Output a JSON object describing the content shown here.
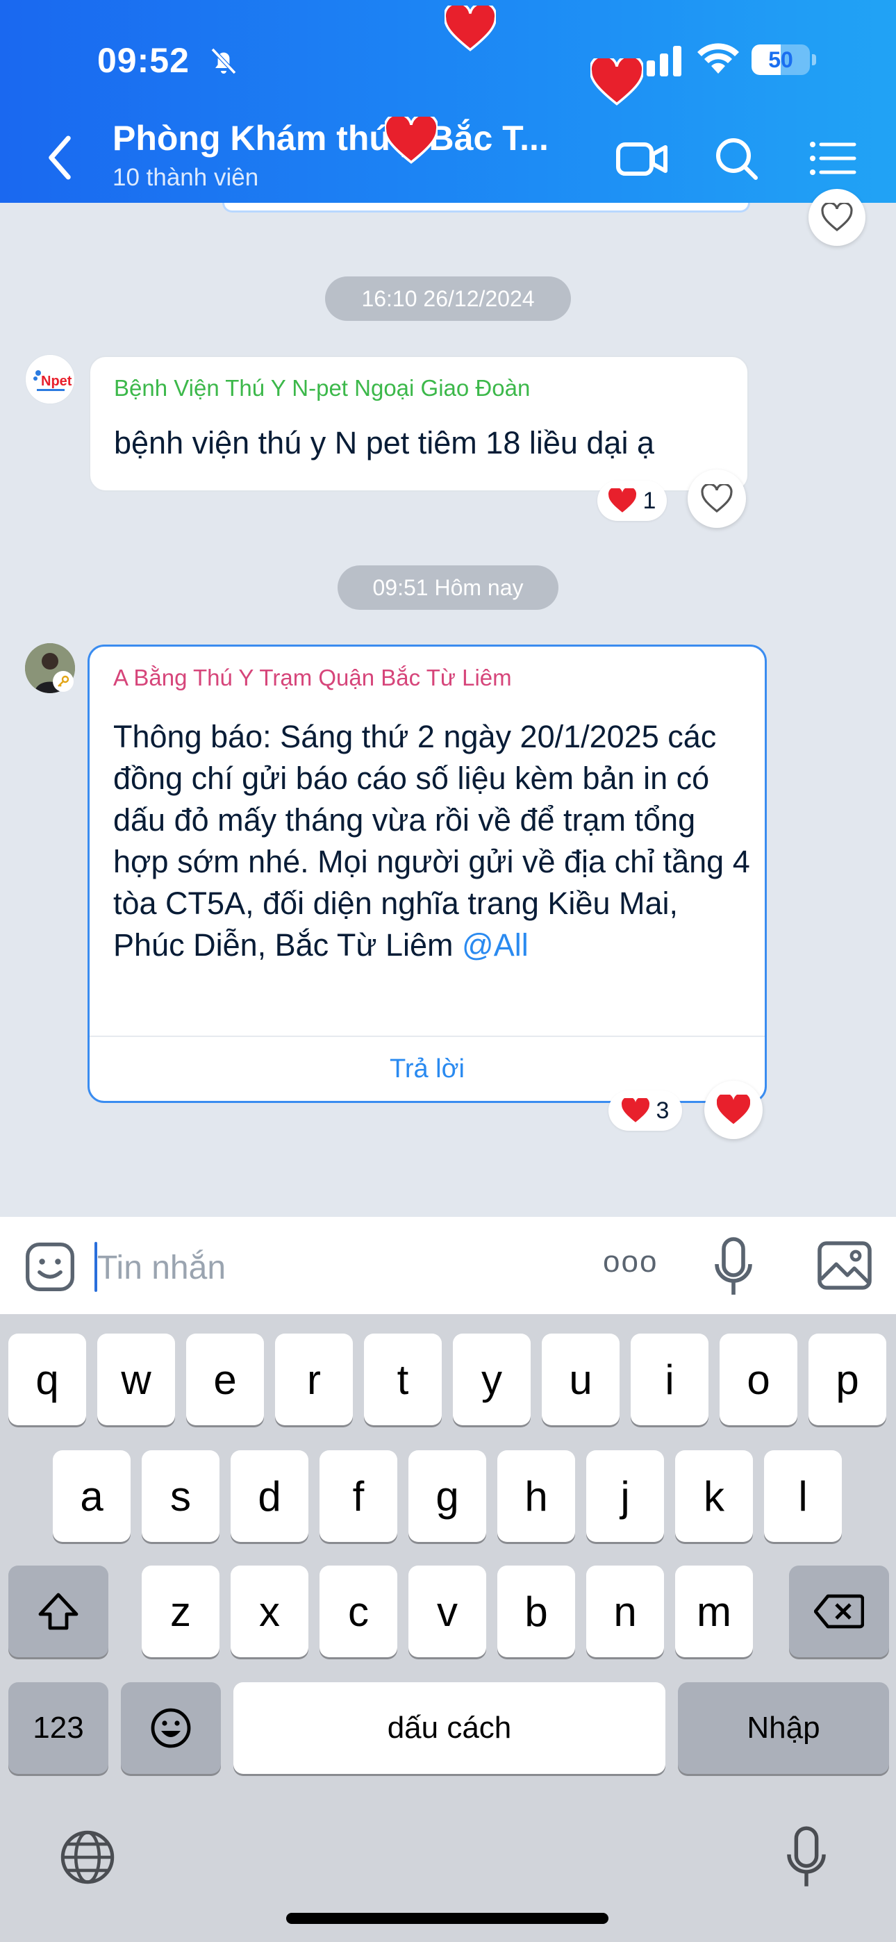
{
  "status_bar": {
    "time": "09:52",
    "battery": "50",
    "battery_level": 0.5
  },
  "header": {
    "title": "Phòng Khám thú y Bắc T...",
    "subtitle": "10 thành viên"
  },
  "messages": [
    {
      "timestamp": "16:10 26/12/2024",
      "sender": "Bệnh Viện Thú Y N-pet Ngoại Giao Đoàn",
      "avatar_text": "Npet",
      "sender_color": "#3cb84a",
      "text": "bệnh viện thú y N pet tiêm 18 liều dại ạ",
      "reaction_count": "1"
    },
    {
      "timestamp": "09:51 Hôm nay",
      "sender": "A Bằng Thú Y Trạm Quận Bắc Từ Liêm",
      "sender_color": "#d6457a",
      "text": "Thông báo: Sáng thứ 2 ngày 20/1/2025 các đồng chí gửi báo cáo số liệu kèm bản in có dấu đỏ mấy tháng vừa rồi về để trạm tổng hợp sớm nhé. Mọi người gửi về địa chỉ tầng 4 tòa CT5A, đối diện nghĩa trang Kiều Mai, Phúc Diễn, Bắc Từ Liêm",
      "mention": "@All",
      "reply_label": "Trả lời",
      "reaction_count": "3"
    }
  ],
  "composer": {
    "placeholder": "Tin nhắn",
    "more_label": "ooo"
  },
  "keyboard": {
    "row1": [
      "q",
      "w",
      "e",
      "r",
      "t",
      "y",
      "u",
      "i",
      "o",
      "p"
    ],
    "row2": [
      "a",
      "s",
      "d",
      "f",
      "g",
      "h",
      "j",
      "k",
      "l"
    ],
    "row3": [
      "z",
      "x",
      "c",
      "v",
      "b",
      "n",
      "m"
    ],
    "numbers_label": "123",
    "space_label": "dấu cách",
    "return_label": "Nhập"
  },
  "colors": {
    "header_start": "#1a68f0",
    "header_end": "#21a3f5",
    "accent": "#2a6fdb",
    "heart": "#e8202c"
  }
}
